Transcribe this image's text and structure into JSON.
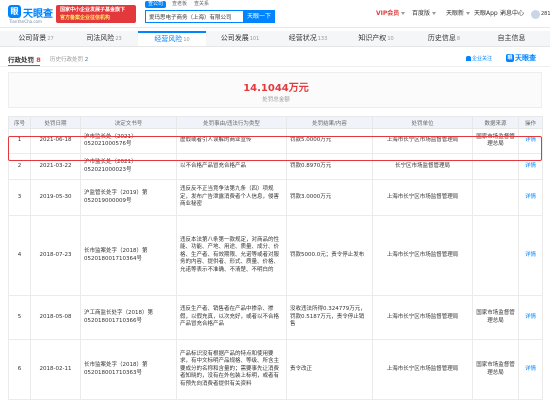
{
  "header": {
    "logo_text": "天眼查",
    "logo_url": "TianYanCha.com",
    "promo_line1": "国家中小企业发展子基金旗下",
    "promo_line2": "官方备案企业征信机构",
    "search_tabs": [
      "查公司",
      "查老板",
      "查关系"
    ],
    "search_value": "爱玛思电子商务（上海）有限公司",
    "search_button": "天眼一下",
    "nav": {
      "vip": "VIP会员",
      "baidu": "百度版",
      "tianyan_new": "天眼新",
      "app": "天眼App",
      "messages": "消息中心",
      "user": "2813..."
    }
  },
  "module_tabs": [
    {
      "label": "公司背景",
      "count": "27"
    },
    {
      "label": "司法风险",
      "count": "23"
    },
    {
      "label": "经营风险",
      "count": "10"
    },
    {
      "label": "公司发展",
      "count": "101"
    },
    {
      "label": "经营状况",
      "count": "133"
    },
    {
      "label": "知识产权",
      "count": "10"
    },
    {
      "label": "历史信息",
      "count": "8"
    },
    {
      "label": "自主信息",
      "count": ""
    }
  ],
  "sub_tabs": {
    "active_label": "行政处罚",
    "active_count": "8",
    "history_label": "历史行政处罚",
    "history_count": "2",
    "alert_label": "企业关注",
    "watermark": "天眼查"
  },
  "summary": {
    "amount": "14.1044万元",
    "label": "处罚总金额"
  },
  "table": {
    "columns": [
      "序号",
      "处罚日期",
      "决定文书号",
      "处罚事由/违法行为类型",
      "处罚结果/内容",
      "处罚单位",
      "数据来源",
      "操作"
    ],
    "rows": [
      {
        "no": "1",
        "date": "2021-06-18",
        "doc": "沪市监长处〔2021〕052021000576号",
        "reason": "虚假或者引人误解的商业宣传",
        "result": "罚款5.0000万元",
        "unit": "上海市长宁区市场监督管理局",
        "source": "国家市场监督管理总局",
        "action": "详情"
      },
      {
        "no": "2",
        "date": "2021-03-22",
        "doc": "沪市监长处〔2021〕052021000023号",
        "reason": "以不合格产品冒充合格产品",
        "result": "罚款0.8970万元",
        "unit": "长宁区市场监督管理局",
        "source": "",
        "action": "详情"
      },
      {
        "no": "3",
        "date": "2019-05-30",
        "doc": "沪监管长处字（2019）第052019000009号",
        "reason": "违反反不正当竞争法第九条（四）项规定，发布广告泄露消费者个人信息，侵害商业秘密",
        "result": "罚款3.0000万元",
        "unit": "上海市长宁区市场监督管理局",
        "source": "",
        "action": "详情"
      },
      {
        "no": "4",
        "date": "2018-07-23",
        "doc": "长市监案处字（2018）第052018001710364号",
        "reason": "违反本法第八条第一款规定，对商品的性能、功能、产地、用途、质量、成分、价格、生产者、有效期限、允诺等或者对服务的内容、提供者、形式、质量、价格、允诺等表示不准确、不清楚、不明白的",
        "result": "罚款5000.0元；责令停止发布",
        "unit": "上海市长宁区市场监督管理局",
        "source": "",
        "action": "详情"
      },
      {
        "no": "5",
        "date": "2018-05-08",
        "doc": "沪工商监长处字（2018）第052018001710366号",
        "reason": "违反生产者、销售者在产品中掺杂、掺假，以假充真，以次充好，或者以不合格产品冒充合格产品",
        "result": "没收违法所得0.324779万元，罚款0.5187万元，责令停止销售",
        "unit": "上海市长宁区市场监督管理局",
        "source": "国家市场监督管理总局",
        "action": "详情"
      },
      {
        "no": "6",
        "date": "2018-02-11",
        "doc": "长市监案处字（2018）第052018001710363号",
        "reason": "产品标识没有根据产品的特点和使用要求，有中文标明产品规格、等级、所含主要成分的名称和含量的；需要事先让消费者知晓的，没有在外包装上标明，或者有有预先向消费者提供有关资料",
        "result": "责令改正",
        "unit": "上海市长宁区市场监督管理局",
        "source": "国家市场监督管理总局",
        "action": "详情"
      }
    ]
  }
}
